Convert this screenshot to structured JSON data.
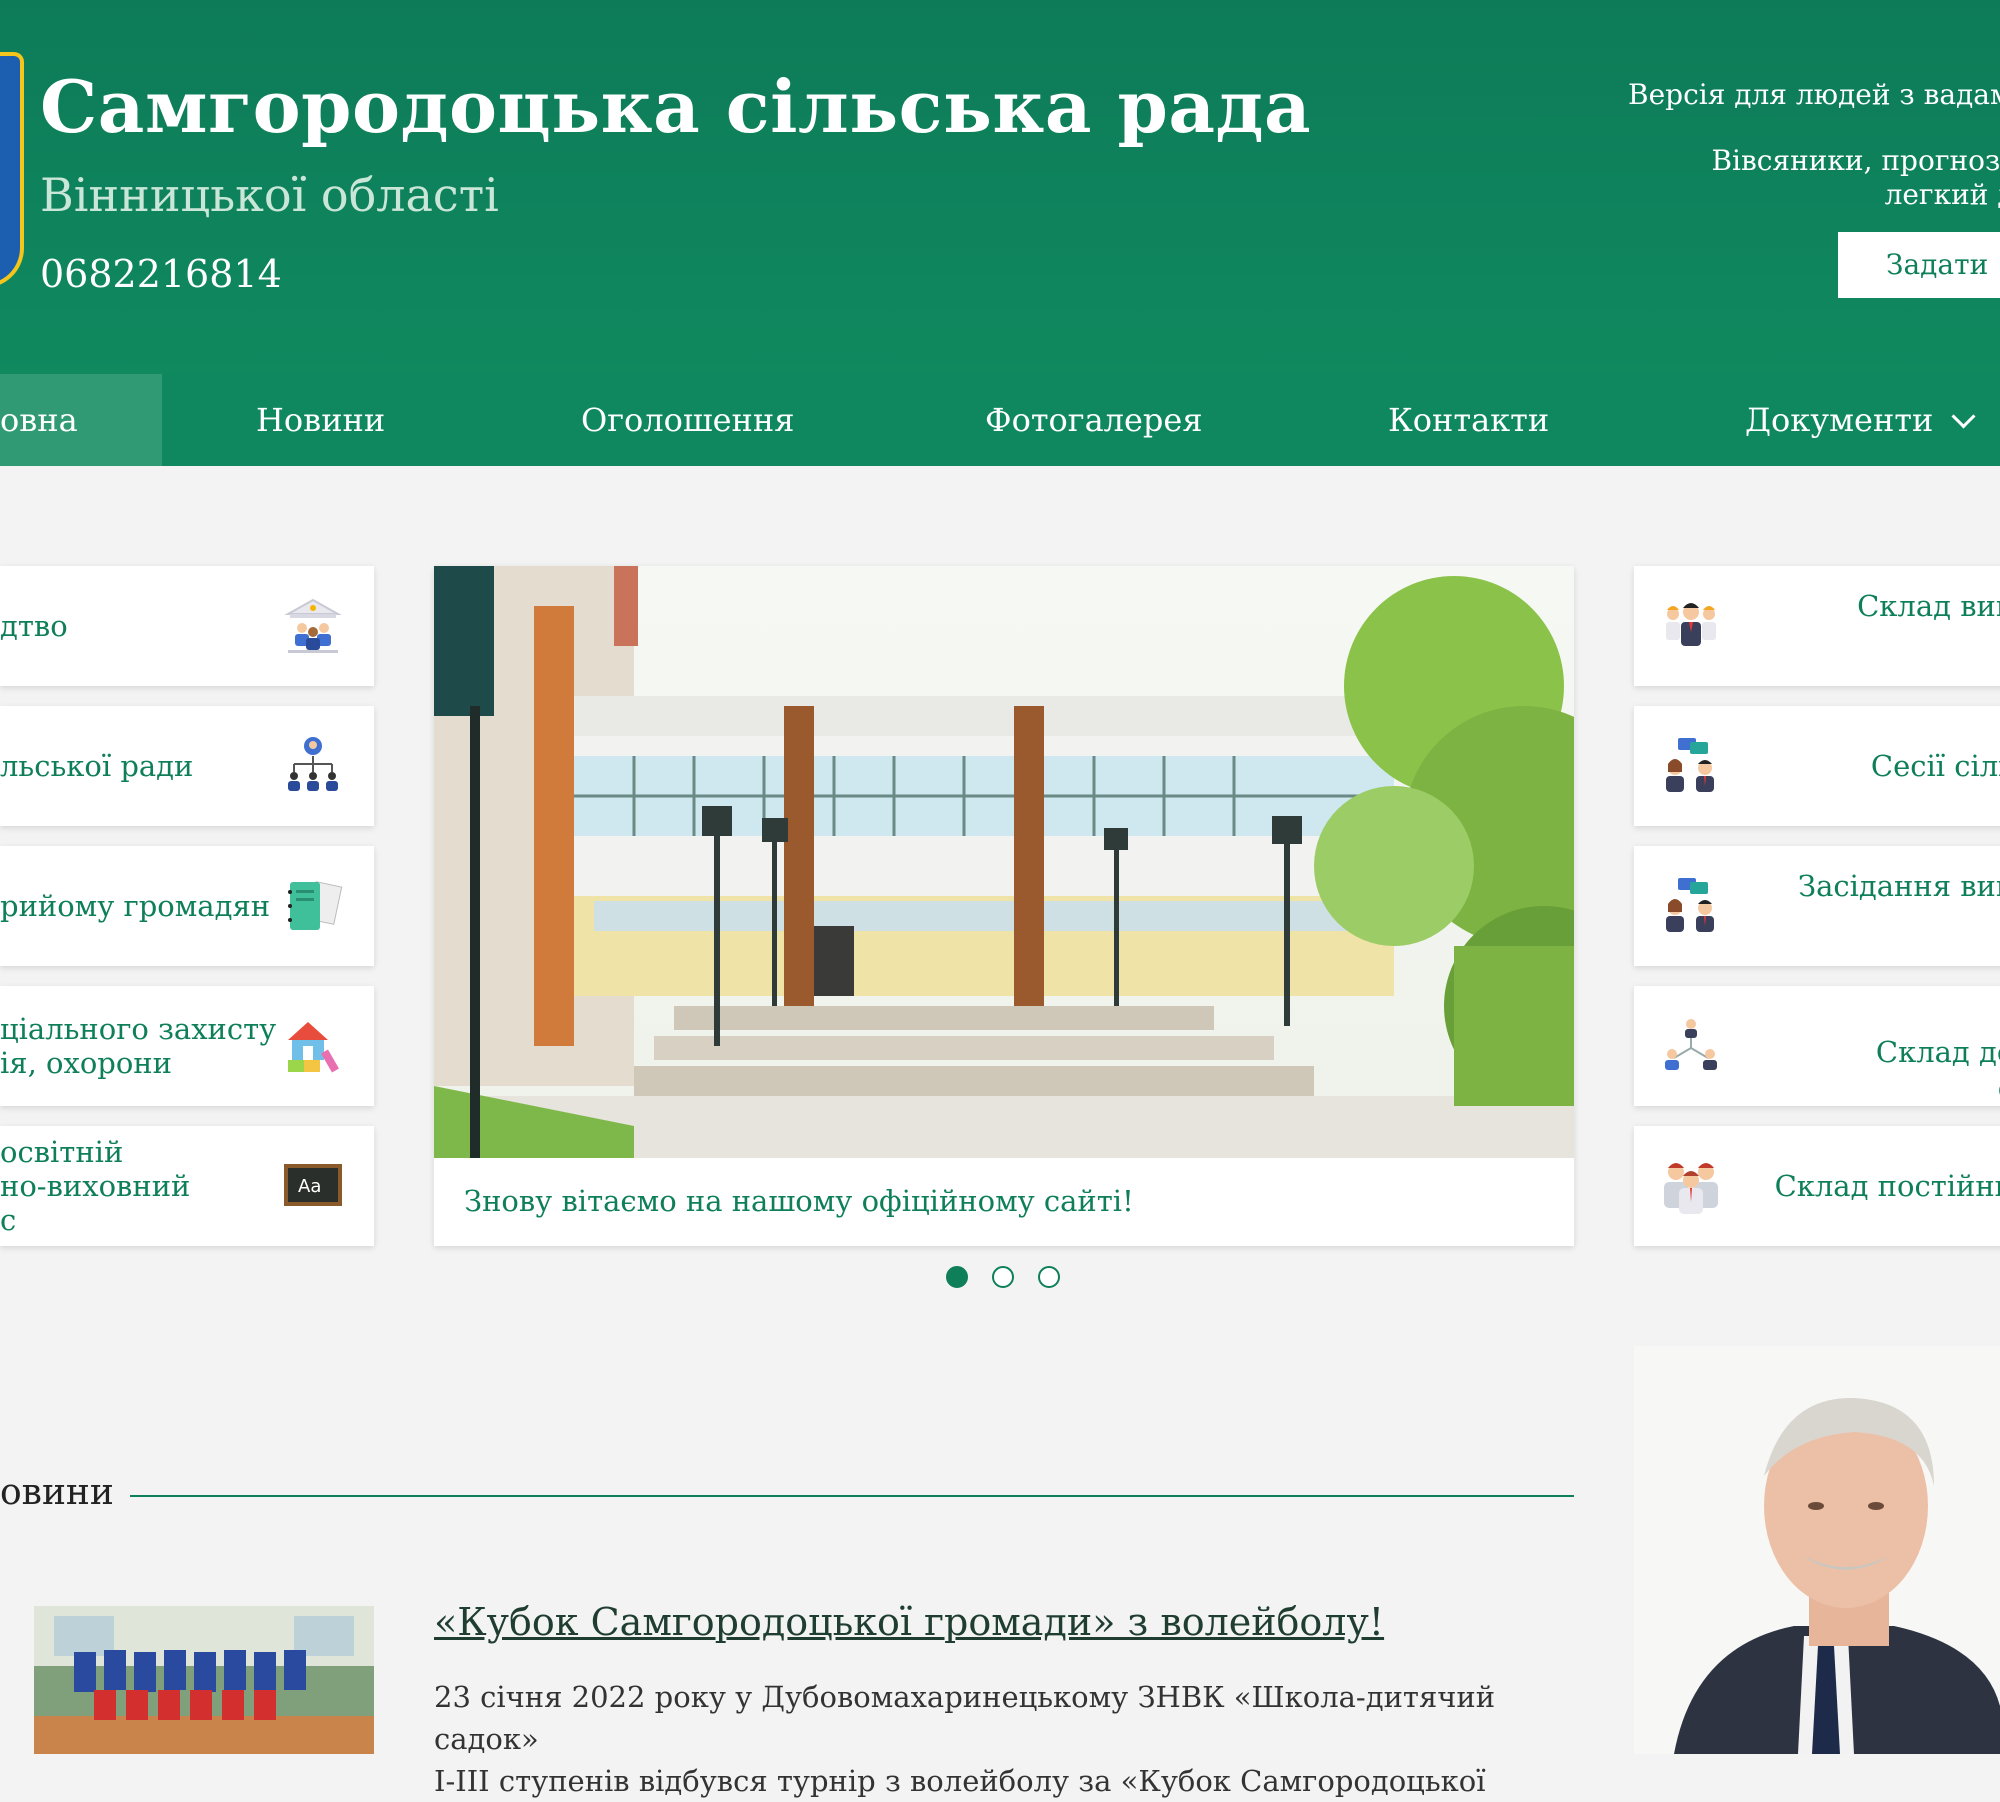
{
  "header": {
    "title": "Самгородоцька сільська рада",
    "subtitle": "Вінницької області",
    "phone": "0682216814",
    "accessibility_link": "Версія для людей з вадам",
    "weather_line1": "Вівсяники, прогноз на",
    "weather_line2": "легкий до",
    "ask_button": "Задати"
  },
  "nav": {
    "items": [
      {
        "label": "овна"
      },
      {
        "label": "Новини"
      },
      {
        "label": "Оголошення"
      },
      {
        "label": "Фотогалерея"
      },
      {
        "label": "Контакти"
      },
      {
        "label": "Документи"
      }
    ]
  },
  "left_cards": [
    {
      "line1": "дтво",
      "line2": "",
      "icon": "leadership-icon"
    },
    {
      "line1": "льської ради",
      "line2": "",
      "icon": "org-structure-icon"
    },
    {
      "line1": "рийому громадян",
      "line2": "",
      "icon": "notebook-icon"
    },
    {
      "line1": "ціального захисту",
      "line2": "ія, охорони",
      "icon": "house-blocks-icon"
    },
    {
      "line1": "освітній",
      "line2": "но-виховний",
      "line3": "с",
      "icon": "chalkboard-icon"
    }
  ],
  "slider": {
    "caption": "Знову вітаємо на нашому офіційному сайті!",
    "active_index": 0,
    "dot_count": 3
  },
  "right_cards": [
    {
      "line1": "Склад вик",
      "line2": "",
      "icon": "team-icon"
    },
    {
      "line1": "Сесії сіль",
      "line2": "",
      "icon": "discussion-icon"
    },
    {
      "line1": "Засідання вик",
      "line2": "",
      "icon": "discussion-icon"
    },
    {
      "line1": "Склад де",
      "line2": "с",
      "icon": "network-icon"
    },
    {
      "line1": "Склад постійни",
      "line2": "",
      "icon": "group-icon"
    }
  ],
  "news": {
    "heading": "овини",
    "items": [
      {
        "title": "«Кубок Самгородоцької громади» з волейболу!",
        "text_line1": "23 січня 2022 року у Дубовомахаринецькому ЗНВК «Школа-дитячий садок»",
        "text_line2": "І-ІІІ ступенів відбувся турнір з волейболу за «Кубок Самгородоцької"
      }
    ]
  },
  "colors": {
    "brand_green": "#10895f",
    "nav_green": "#0f8860",
    "link_green": "#0f7f5a",
    "page_bg": "#f2f3f2"
  }
}
